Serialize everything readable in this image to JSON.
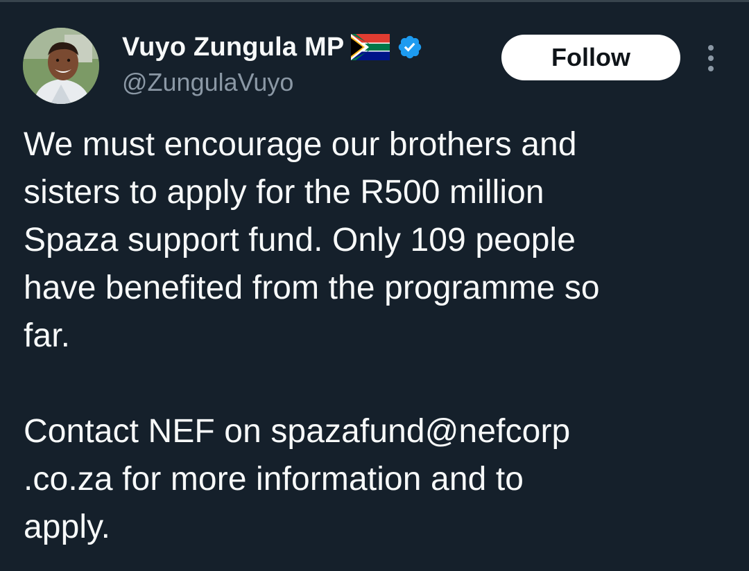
{
  "tweet": {
    "author": {
      "display_name": "Vuyo Zungula MP",
      "handle": "@ZungulaVuyo",
      "flag_icon": "south-africa-flag-icon",
      "verified_icon": "verified-badge-icon",
      "verified_color": "#1d9bf0"
    },
    "follow_label": "Follow",
    "more_icon": "more-options-icon",
    "text_lines": [
      "We must encourage our brothers and",
      "sisters to apply for the R500 million",
      "Spaza support fund. Only 109 people",
      "have benefited from the programme so",
      "far.",
      "",
      "Contact NEF on spazafund@nefcorp",
      ".co.za for more information and to",
      "apply."
    ]
  },
  "theme": {
    "background": "#15202b",
    "text_primary": "#f7f9f9",
    "text_secondary": "#8b98a5",
    "button_background": "#ffffff",
    "button_text": "#0f1419"
  }
}
